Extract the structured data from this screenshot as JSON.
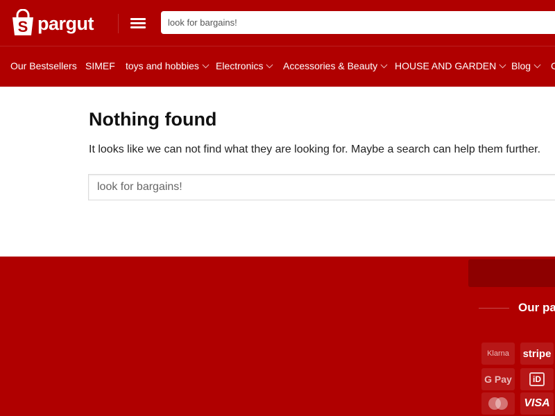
{
  "brand": {
    "name": "Spargut",
    "logo_text": "pargut",
    "logo_letter": "S"
  },
  "header": {
    "menu_icon": "hamburger-menu-icon",
    "search_placeholder": "look for bargains!"
  },
  "nav": {
    "items": [
      {
        "label": "Our Bestsellers",
        "has_dropdown": false
      },
      {
        "label": "SIMEF",
        "has_dropdown": false
      },
      {
        "label": "toys and hobbies",
        "has_dropdown": true
      },
      {
        "label": "Electronics",
        "has_dropdown": true
      },
      {
        "label": "Accessories & Beauty",
        "has_dropdown": true
      },
      {
        "label": "HOUSE AND GARDEN",
        "has_dropdown": true
      },
      {
        "label": "Blog",
        "has_dropdown": true
      },
      {
        "label": "C",
        "has_dropdown": false
      }
    ]
  },
  "main": {
    "title": "Nothing found",
    "message": "It looks like we can not find what they are looking for. Maybe a search can help them further.",
    "search_placeholder": "look for bargains!"
  },
  "footer": {
    "heading": "Our pa",
    "payment_methods": [
      {
        "name": "Klarna",
        "label": "Klarna"
      },
      {
        "name": "stripe",
        "label": "stripe"
      },
      {
        "name": "G Pay",
        "label": "G Pay"
      },
      {
        "name": "iDEAL",
        "label": "iD"
      },
      {
        "name": "Mastercard",
        "label": ""
      },
      {
        "name": "VISA",
        "label": "VISA"
      }
    ]
  },
  "colors": {
    "brand_red": "#b00000",
    "footer_button": "#8d0000",
    "text_dark": "#111111",
    "white": "#ffffff"
  }
}
